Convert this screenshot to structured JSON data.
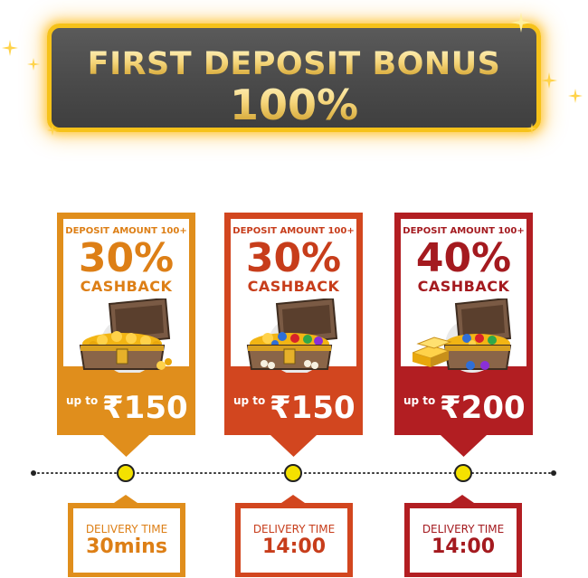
{
  "banner": {
    "title": "FIRST DEPOSIT BONUS",
    "percent": "100%"
  },
  "colors": {
    "orange": "#e08e1c",
    "orange_text": "#dd7f16",
    "redorange": "#d2461f",
    "redorange_text": "#c73d1b",
    "red": "#b21e22",
    "red_text": "#a41a1f",
    "gold": "#f6c21a",
    "dot": "#f4e100"
  },
  "cards": [
    {
      "deposit": "DEPOSIT AMOUNT 100+",
      "percent": "30%",
      "cashback": "CASHBACK",
      "upto": "up to",
      "amount": "₹150",
      "icon": "treasure-chest-gold-icon"
    },
    {
      "deposit": "DEPOSIT AMOUNT 100+",
      "percent": "30%",
      "cashback": "CASHBACK",
      "upto": "up to",
      "amount": "₹150",
      "icon": "treasure-chest-jewels-icon"
    },
    {
      "deposit": "DEPOSIT AMOUNT 100+",
      "percent": "40%",
      "cashback": "CASHBACK",
      "upto": "up to",
      "amount": "₹200",
      "icon": "treasure-chest-gold-bars-icon"
    }
  ],
  "delivery": [
    {
      "label": "DELIVERY TIME",
      "value": "30mins"
    },
    {
      "label": "DELIVERY TIME",
      "value": "14:00"
    },
    {
      "label": "DELIVERY TIME",
      "value": "14:00"
    }
  ]
}
